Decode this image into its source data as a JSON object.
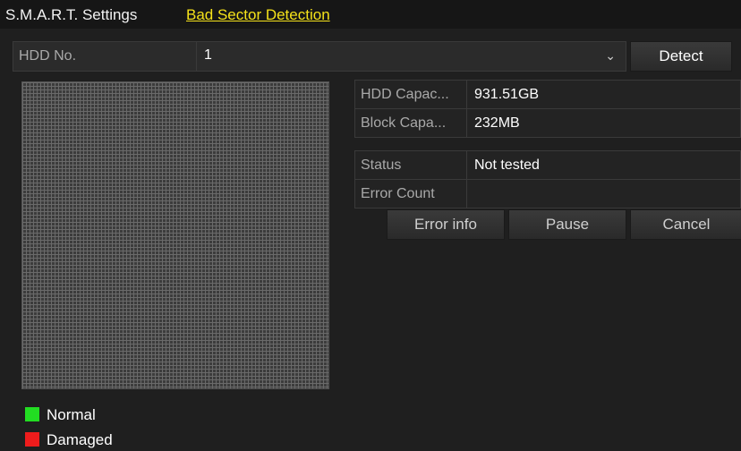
{
  "tabs": {
    "smart": "S.M.A.R.T. Settings",
    "bad_sector": "Bad Sector Detection"
  },
  "hdd": {
    "label": "HDD No.",
    "value": "1"
  },
  "buttons": {
    "detect": "Detect",
    "error_info": "Error info",
    "pause": "Pause",
    "cancel": "Cancel"
  },
  "info": {
    "hdd_capacity_label": "HDD Capac...",
    "hdd_capacity_value": "931.51GB",
    "block_capacity_label": "Block Capa...",
    "block_capacity_value": "232MB",
    "status_label": "Status",
    "status_value": "Not tested",
    "error_count_label": "Error Count",
    "error_count_value": ""
  },
  "legend": {
    "normal": "Normal",
    "normal_color": "#22dd22",
    "damaged": "Damaged",
    "damaged_color": "#ee1c1c"
  },
  "colors": {
    "accent_tab": "#f5e21a"
  }
}
